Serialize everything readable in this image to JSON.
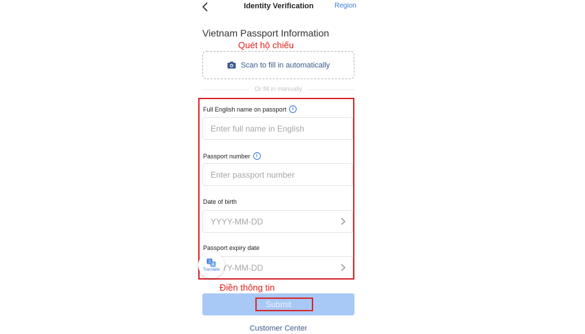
{
  "nav": {
    "title": "Identity Verification",
    "region_label": "Region"
  },
  "page_title": "Vietnam Passport Information",
  "annotations": {
    "scan": "Quét hộ chiếu",
    "fill": "Điền thông tin"
  },
  "scan": {
    "label": "Scan to fill in automatically",
    "icon": "camera-icon"
  },
  "or_fill_manually": "Or fill in manually",
  "fields": [
    {
      "label": "Full English name on passport",
      "placeholder": "Enter full name in English",
      "has_info": true,
      "type": "text"
    },
    {
      "label": "Passport number",
      "placeholder": "Enter passport number",
      "has_info": true,
      "type": "text"
    },
    {
      "label": "Date of birth",
      "placeholder": "YYYY-MM-DD",
      "has_info": false,
      "type": "date"
    },
    {
      "label": "Passport expiry date",
      "placeholder": "YYYY-MM-DD",
      "has_info": false,
      "type": "date"
    }
  ],
  "translate": {
    "label": "Translate",
    "icon": "translate-icon"
  },
  "submit_label": "Submit",
  "customer_center": "Customer Center",
  "colors": {
    "accent": "#3a7bd5",
    "annotation_red": "#d9272e",
    "submit_disabled": "#a8c8f5"
  }
}
